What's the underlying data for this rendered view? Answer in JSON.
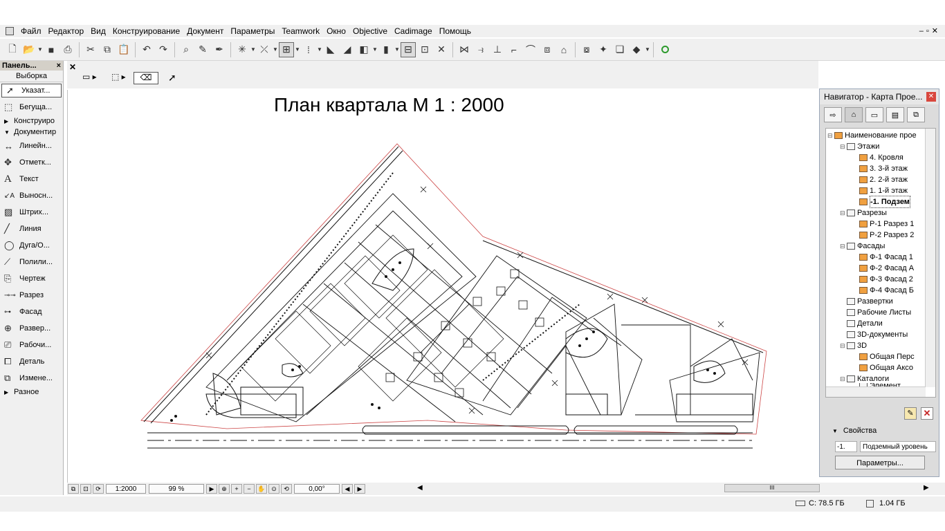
{
  "menu": {
    "items": [
      "Файл",
      "Редактор",
      "Вид",
      "Конструирование",
      "Документ",
      "Параметры",
      "Teamwork",
      "Окно",
      "Objective",
      "Cadimage",
      "Помощь"
    ]
  },
  "toolpanel": {
    "title": "Панель...",
    "close": "×",
    "selection_label": "Выборка",
    "pointer": "Указат...",
    "marquee": "Бегуща...",
    "section_design": "Конструиро",
    "section_document": "Документир",
    "tools": [
      "Линейн...",
      "Отметк...",
      "Текст",
      "Выносн...",
      "Штрих...",
      "Линия",
      "Дуга/О...",
      "Полили...",
      "Чертеж",
      "Разрез",
      "Фасад",
      "Развер...",
      "Рабочи...",
      "Деталь",
      "Измене..."
    ],
    "section_more": "Разное"
  },
  "drawing": {
    "title": "План квартала М 1 : 2000"
  },
  "navigator": {
    "title": "Навигатор - Карта Прое...",
    "tree": {
      "root": "Наименование прое",
      "stories": "Этажи",
      "story_4": "4. Кровля",
      "story_3": "3. 3-й этаж",
      "story_2": "2. 2-й этаж",
      "story_1": "1. 1-й этаж",
      "story_m1": "-1. Подзем",
      "sections": "Разрезы",
      "section_1": "Р-1 Разрез 1",
      "section_2": "Р-2 Разрез 2",
      "elevations": "Фасады",
      "elevation_1": "Ф-1 Фасад 1",
      "elevation_2": "Ф-2 Фасад А",
      "elevation_3": "Ф-3 Фасад 2",
      "elevation_4": "Ф-4 Фасад Б",
      "unfolds": "Развертки",
      "worksheets": "Рабочие Листы",
      "details": "Детали",
      "docs3d": "3D-документы",
      "view3d": "3D",
      "persp": "Общая Перс",
      "axon": "Общая Аксо",
      "catalogs": "Каталоги",
      "element": "Элемент"
    },
    "properties_label": "Свойства",
    "layer_index": "-1.",
    "layer_name": "Подземный уровень",
    "params_button": "Параметры..."
  },
  "bottombar": {
    "scale": "1:2000",
    "zoom": "99 %",
    "angle": "0,00°",
    "scroll_grip": "III"
  },
  "status": {
    "disk": "С: 78.5 ГБ",
    "memory": "1.04 ГБ"
  }
}
